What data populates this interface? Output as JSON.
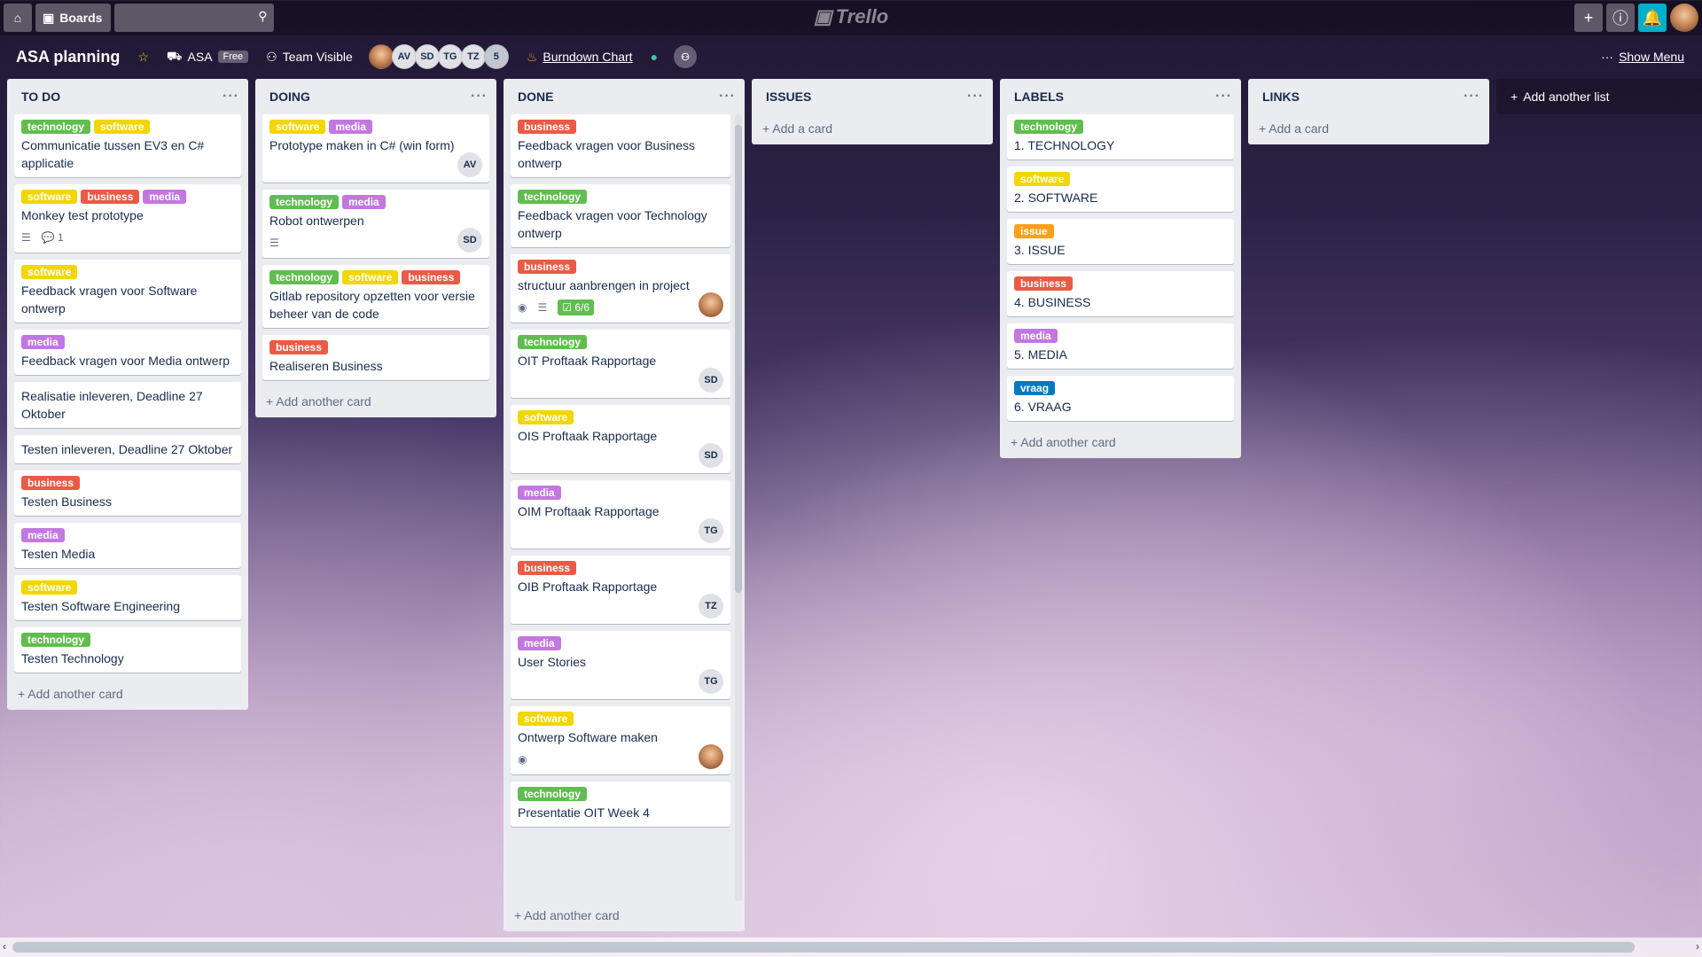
{
  "topbar": {
    "boards_label": "Boards",
    "search_placeholder": "",
    "logo_text": "Trello"
  },
  "board": {
    "title": "ASA planning",
    "team": "ASA",
    "team_badge": "Free",
    "visibility": "Team Visible",
    "members": [
      "AV",
      "SD",
      "TG",
      "TZ"
    ],
    "members_more": "5",
    "burndown": "Burndown Chart",
    "show_menu": "Show Menu"
  },
  "lists": [
    {
      "title": "TO DO",
      "add": "Add another card",
      "cards": [
        {
          "labels": [
            "technology",
            "software"
          ],
          "title": "Communicatie tussen EV3 en C# applicatie"
        },
        {
          "labels": [
            "software",
            "business",
            "media"
          ],
          "title": "Monkey test prototype",
          "comments": "1"
        },
        {
          "labels": [
            "software"
          ],
          "title": "Feedback vragen voor Software ontwerp"
        },
        {
          "labels": [
            "media"
          ],
          "title": "Feedback vragen voor Media ontwerp"
        },
        {
          "labels": [],
          "title": "Realisatie inleveren, Deadline 27 Oktober"
        },
        {
          "labels": [],
          "title": "Testen inleveren, Deadline 27 Oktober"
        },
        {
          "labels": [
            "business"
          ],
          "title": "Testen Business"
        },
        {
          "labels": [
            "media"
          ],
          "title": "Testen Media"
        },
        {
          "labels": [
            "software"
          ],
          "title": "Testen Software Engineering"
        },
        {
          "labels": [
            "technology"
          ],
          "title": "Testen Technology"
        }
      ]
    },
    {
      "title": "DOING",
      "add": "Add another card",
      "cards": [
        {
          "labels": [
            "software",
            "media"
          ],
          "title": "Prototype maken in C# (win form)",
          "member": "AV"
        },
        {
          "labels": [
            "technology",
            "media"
          ],
          "title": "Robot ontwerpen",
          "member": "SD"
        },
        {
          "labels": [
            "technology",
            "software",
            "business"
          ],
          "title": "Gitlab repository opzetten voor versie beheer van de code"
        },
        {
          "labels": [
            "business"
          ],
          "title": "Realiseren Business"
        }
      ]
    },
    {
      "title": "DONE",
      "add": "Add another card",
      "cards": [
        {
          "labels": [
            "business"
          ],
          "title": "Feedback vragen voor Business ontwerp"
        },
        {
          "labels": [
            "technology"
          ],
          "title": "Feedback vragen voor Technology ontwerp"
        },
        {
          "labels": [
            "business"
          ],
          "title": "structuur aanbrengen in project",
          "checklist": "6/6"
        },
        {
          "labels": [
            "technology"
          ],
          "title": "OIT Proftaak Rapportage",
          "member": "SD"
        },
        {
          "labels": [
            "software"
          ],
          "title": "OIS Proftaak Rapportage",
          "member": "SD"
        },
        {
          "labels": [
            "media"
          ],
          "title": "OIM Proftaak Rapportage",
          "member": "TG"
        },
        {
          "labels": [
            "business"
          ],
          "title": "OIB Proftaak Rapportage",
          "member": "TZ"
        },
        {
          "labels": [
            "media"
          ],
          "title": "User Stories",
          "member": "TG"
        },
        {
          "labels": [
            "software"
          ],
          "title": "Ontwerp Software maken"
        },
        {
          "labels": [
            "technology"
          ],
          "title": "Presentatie OIT Week 4"
        }
      ]
    },
    {
      "title": "ISSUES",
      "add": "Add a card",
      "cards": []
    },
    {
      "title": "LABELS",
      "add": "Add another card",
      "cards": [
        {
          "labels": [
            "technology"
          ],
          "title": "1. TECHNOLOGY"
        },
        {
          "labels": [
            "software"
          ],
          "title": "2. SOFTWARE"
        },
        {
          "labels": [
            "issue"
          ],
          "title": "3. ISSUE"
        },
        {
          "labels": [
            "business"
          ],
          "title": "4. BUSINESS"
        },
        {
          "labels": [
            "media"
          ],
          "title": "5. MEDIA"
        },
        {
          "labels": [
            "vraag"
          ],
          "title": "6. VRAAG"
        }
      ]
    },
    {
      "title": "LINKS",
      "add": "Add a card",
      "cards": []
    }
  ],
  "add_list": "Add another list",
  "colors": {
    "technology": "#61bd4f",
    "software": "#f2d600",
    "business": "#eb5a46",
    "media": "#c377e0",
    "issue": "#ff9f1a",
    "vraag": "#0079bf"
  }
}
